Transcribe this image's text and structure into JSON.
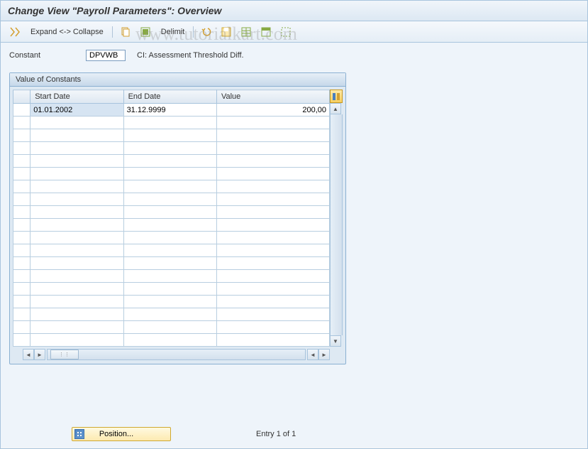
{
  "title": "Change View \"Payroll Parameters\": Overview",
  "toolbar": {
    "expand_collapse": "Expand <-> Collapse",
    "delimit": "Delimit"
  },
  "form": {
    "constant_label": "Constant",
    "constant_value": "DPVWB",
    "constant_desc": "CI: Assessment Threshold Diff."
  },
  "panel": {
    "title": "Value of Constants",
    "columns": {
      "start": "Start Date",
      "end": "End Date",
      "value": "Value"
    },
    "rows": [
      {
        "start": "01.01.2002",
        "end": "31.12.9999",
        "value": "200,00"
      }
    ]
  },
  "footer": {
    "position_label": "Position...",
    "entry_text": "Entry 1 of 1"
  },
  "watermark": "www.tutorialkart.com"
}
